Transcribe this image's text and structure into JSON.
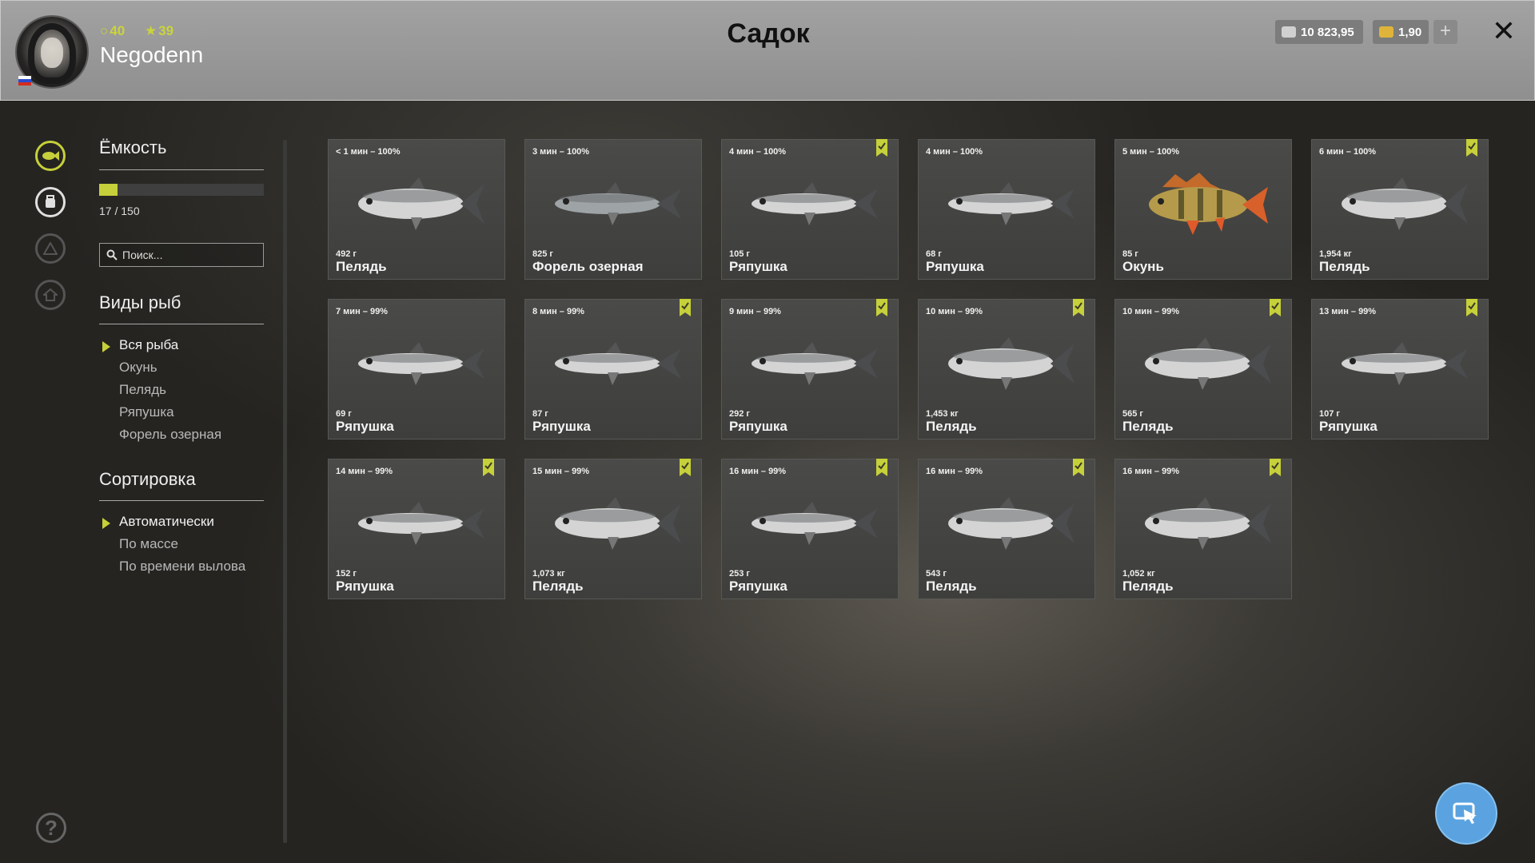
{
  "header": {
    "title": "Садок",
    "username": "Negodenn",
    "level": "40",
    "stars": "39",
    "silver": "10 823,95",
    "gold": "1,90",
    "plus": "+",
    "close": "✕"
  },
  "capacity": {
    "title": "Ёмкость",
    "count_text": "17 / 150",
    "fill_fraction": 0.113,
    "search_placeholder": "Поиск..."
  },
  "species": {
    "title": "Виды рыб",
    "options": [
      "Вся рыба",
      "Окунь",
      "Пелядь",
      "Ряпушка",
      "Форель озерная"
    ],
    "selected": 0
  },
  "sorting": {
    "title": "Сортировка",
    "options": [
      "Автоматически",
      "По массе",
      "По времени вылова"
    ],
    "selected": 0
  },
  "colors": {
    "accent": "#c6d03a",
    "cursor_button": "#5aa3e0"
  },
  "fish": [
    {
      "time": "< 1 мин – 100%",
      "weight": "492 г",
      "name": "Пелядь",
      "bookmarked": false,
      "type": "peled"
    },
    {
      "time": "3 мин – 100%",
      "weight": "825 г",
      "name": "Форель озерная",
      "bookmarked": false,
      "type": "trout"
    },
    {
      "time": "4 мин – 100%",
      "weight": "105 г",
      "name": "Ряпушка",
      "bookmarked": true,
      "type": "vendace"
    },
    {
      "time": "4 мин – 100%",
      "weight": "68 г",
      "name": "Ряпушка",
      "bookmarked": false,
      "type": "vendace"
    },
    {
      "time": "5 мин – 100%",
      "weight": "85 г",
      "name": "Окунь",
      "bookmarked": false,
      "type": "perch"
    },
    {
      "time": "6 мин – 100%",
      "weight": "1,954 кг",
      "name": "Пелядь",
      "bookmarked": true,
      "type": "peled"
    },
    {
      "time": "7 мин – 99%",
      "weight": "69 г",
      "name": "Ряпушка",
      "bookmarked": false,
      "type": "vendace"
    },
    {
      "time": "8 мин – 99%",
      "weight": "87 г",
      "name": "Ряпушка",
      "bookmarked": true,
      "type": "vendace"
    },
    {
      "time": "9 мин – 99%",
      "weight": "292 г",
      "name": "Ряпушка",
      "bookmarked": true,
      "type": "vendace"
    },
    {
      "time": "10 мин – 99%",
      "weight": "1,453 кг",
      "name": "Пелядь",
      "bookmarked": true,
      "type": "peled"
    },
    {
      "time": "10 мин – 99%",
      "weight": "565 г",
      "name": "Пелядь",
      "bookmarked": true,
      "type": "peled"
    },
    {
      "time": "13 мин – 99%",
      "weight": "107 г",
      "name": "Ряпушка",
      "bookmarked": true,
      "type": "vendace"
    },
    {
      "time": "14 мин – 99%",
      "weight": "152 г",
      "name": "Ряпушка",
      "bookmarked": true,
      "type": "vendace"
    },
    {
      "time": "15 мин – 99%",
      "weight": "1,073 кг",
      "name": "Пелядь",
      "bookmarked": true,
      "type": "peled"
    },
    {
      "time": "16 мин – 99%",
      "weight": "253 г",
      "name": "Ряпушка",
      "bookmarked": true,
      "type": "vendace"
    },
    {
      "time": "16 мин – 99%",
      "weight": "543 г",
      "name": "Пелядь",
      "bookmarked": true,
      "type": "peled"
    },
    {
      "time": "16 мин – 99%",
      "weight": "1,052 кг",
      "name": "Пелядь",
      "bookmarked": true,
      "type": "peled"
    }
  ]
}
